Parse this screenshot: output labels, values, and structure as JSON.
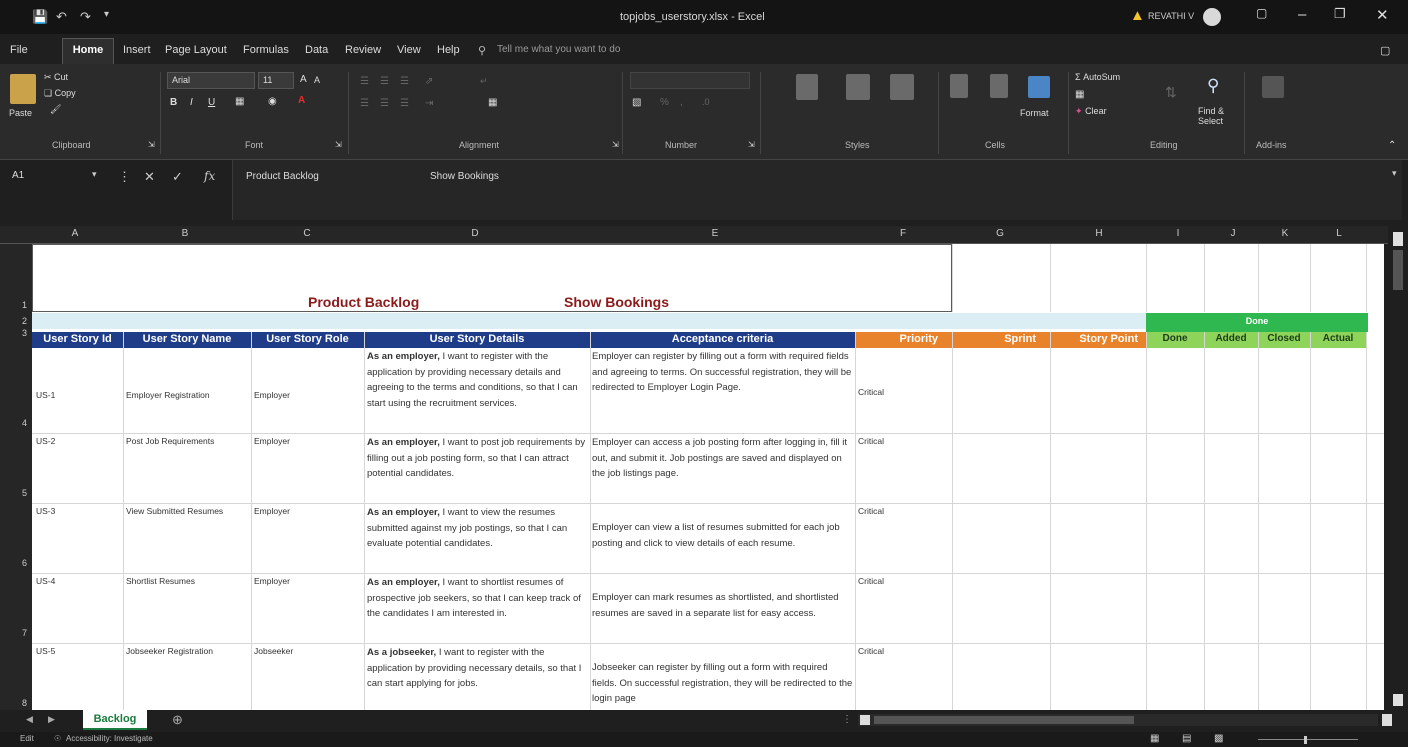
{
  "window": {
    "title": "topjobs_userstory.xlsx - Excel",
    "user": "REVATHI V"
  },
  "menu": {
    "items": [
      "File",
      "Home",
      "Insert",
      "Page Layout",
      "Formulas",
      "Data",
      "Review",
      "View",
      "Help"
    ],
    "tell_me": "Tell me what you want to do"
  },
  "ribbon": {
    "paste": "Paste",
    "cut": "Cut",
    "copy": "Copy",
    "font_name": "Arial",
    "font_size": "11",
    "autosum": "AutoSum",
    "clear": "Clear",
    "find_select": "Find & Select",
    "format": "Format",
    "groups": {
      "clipboard": "Clipboard",
      "font": "Font",
      "alignment": "Alignment",
      "number": "Number",
      "styles": "Styles",
      "cells": "Cells",
      "editing": "Editing",
      "addins": "Add-ins"
    }
  },
  "formula_bar": {
    "name_box": "A1",
    "content": "Product Backlog",
    "content2": "Show Bookings"
  },
  "columns": [
    "A",
    "B",
    "C",
    "D",
    "E",
    "F",
    "G",
    "H",
    "I",
    "J",
    "K",
    "L"
  ],
  "rows": [
    "1",
    "2",
    "3",
    "4",
    "5",
    "6",
    "7",
    "8"
  ],
  "sheet": {
    "title": "Product Backlog",
    "subtitle": "Show Bookings",
    "headers": {
      "id": "User Story Id",
      "name": "User Story Name",
      "role": "User Story Role",
      "details": "User Story Details",
      "criteria": "Acceptance criteria",
      "priority": "Priority",
      "sprint": "Sprint",
      "story_point": "Story Point",
      "status": "Done",
      "done": "Done",
      "added": "Added",
      "closed": "Closed",
      "actual": "Actual"
    },
    "stories": [
      {
        "id": "US-1",
        "name": "Employer Registration",
        "role": "Employer",
        "lead": "As an employer,",
        "details": " I want to register with the application by providing necessary details and agreeing to the terms and conditions, so that I can start using the recruitment services.",
        "criteria": "Employer can register by filling out a form with required fields and agreeing to terms. On successful registration, they will be redirected to Employer Login Page.",
        "priority": "Critical"
      },
      {
        "id": "US-2",
        "name": "Post Job Requirements",
        "role": "Employer",
        "lead": "As an employer,",
        "details": " I want to post job requirements by filling out a job posting form, so that I can attract potential candidates.",
        "criteria": "Employer can access a job posting form after logging in, fill it out, and submit it. Job postings are saved and displayed on the job listings page.",
        "priority": "Critical"
      },
      {
        "id": "US-3",
        "name": "View Submitted Resumes",
        "role": "Employer",
        "lead": "As an employer,",
        "details": " I want to view the resumes submitted against my job postings, so that I can evaluate potential candidates.",
        "criteria": "Employer can view a list of resumes submitted for each job posting and click to view details of each resume.",
        "priority": "Critical"
      },
      {
        "id": "US-4",
        "name": "Shortlist Resumes",
        "role": "Employer",
        "lead": "As an employer,",
        "details": " I want to shortlist resumes of prospective job seekers, so that I can keep track of the candidates I am interested in.",
        "criteria": "Employer can mark resumes as shortlisted, and shortlisted resumes are saved in a separate list for easy access.",
        "priority": "Critical"
      },
      {
        "id": "US-5",
        "name": "Jobseeker Registration",
        "role": "Jobseeker",
        "lead": "As a jobseeker,",
        "details": " I want to register with the application by providing necessary details, so that I can start applying for jobs.",
        "criteria": "Jobseeker can register by filling out a form with required fields. On successful registration, they will be redirected to the login page",
        "priority": "Critical"
      }
    ]
  },
  "tabs": {
    "sheet": "Backlog"
  },
  "status": {
    "mode": "Edit",
    "accessibility": "Accessibility: Investigate"
  }
}
